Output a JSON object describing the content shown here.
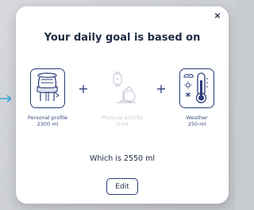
{
  "dialog": {
    "title": "Your daily goal is based on",
    "close_label": "×",
    "factors": [
      {
        "icon": "person-body-icon",
        "label": "Personal profile",
        "amount": "2300 ml",
        "active": true
      },
      {
        "icon": "watch-bike-icon",
        "label": "Physical activity",
        "amount": "0 ml",
        "active": false
      },
      {
        "icon": "weather-thermometer-icon",
        "label": "Weather",
        "amount": "250 ml",
        "active": true
      }
    ],
    "plus_symbol": "+",
    "result_text": "Which is 2550 ml",
    "edit_label": "Edit"
  },
  "colors": {
    "accent": "#2b3c7a",
    "text": "#1f2a44",
    "dimmed": "#c7cad6",
    "pointer": "#3aa8d8"
  }
}
